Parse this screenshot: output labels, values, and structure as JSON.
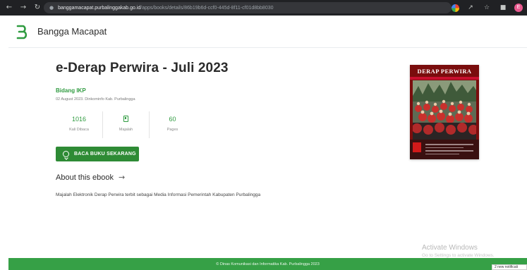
{
  "browser": {
    "url_host": "banggamacapat.purbalinggakab.go.id",
    "url_path": "/apps/books/details/86b19b6d-ccf0-445d-8f11-cf01d8bb8030",
    "profile_initial": "E"
  },
  "app": {
    "brand": "Bangga Macapat",
    "accent": "#2f9b40"
  },
  "book": {
    "title": "e-Derap Perwira - Juli 2023",
    "author": "Bidang IKP",
    "meta": "02 August 2023. Dinkominfo Kab. Purbalingga",
    "stats": [
      {
        "value": "1016",
        "label": "Kali Dibaca"
      },
      {
        "value": "",
        "label": "Majalah",
        "icon": "book-icon"
      },
      {
        "value": "60",
        "label": "Pages"
      }
    ],
    "read_button": "BACA BUKU SEKARANG",
    "about_heading": "About this ebook",
    "description": "Majalah Elektronik Derap Perwira terbit sebagai Media Informasi Pemerintah Kabupaten Purbalingga",
    "cover_title": "DERAP PERWIRA"
  },
  "footer": {
    "text": "© Dinas Komunikasi dan Informatika Kab. Purbalingga 2023"
  },
  "os": {
    "watermark_title": "Activate Windows",
    "watermark_sub": "Go to Settings to activate Windows.",
    "toast": "2 new notificati"
  }
}
